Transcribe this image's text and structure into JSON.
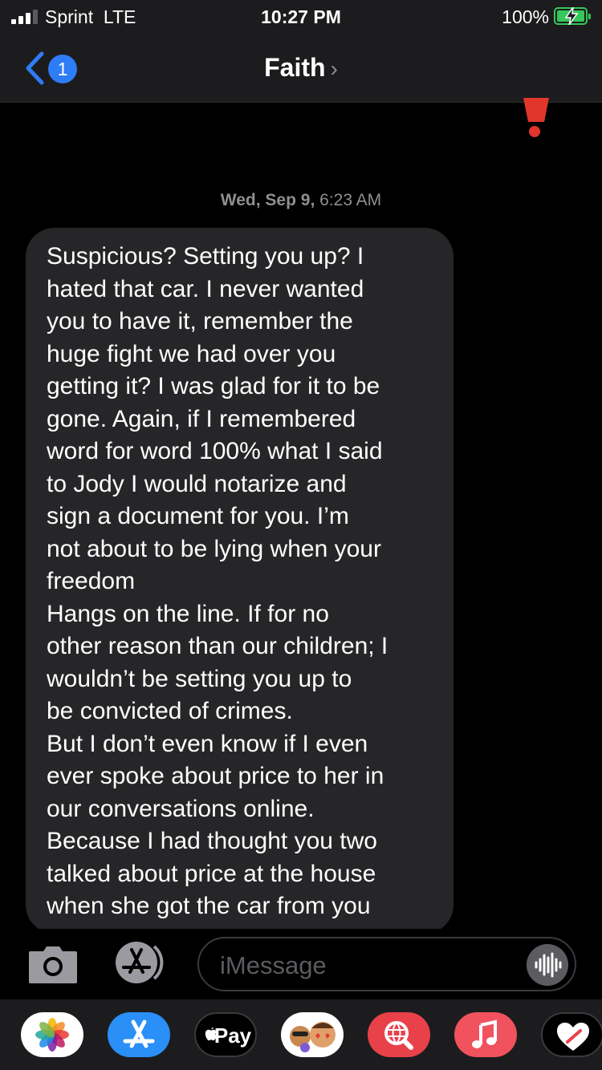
{
  "status_bar": {
    "carrier": "Sprint",
    "network": "LTE",
    "time": "10:27 PM",
    "battery_percent": "100%",
    "battery_state": "charging",
    "signal_bars": 3,
    "signal_max": 4
  },
  "nav": {
    "back_badge": "1",
    "contact_name": "Faith",
    "contact_chevron": "›"
  },
  "error_indicator": {
    "icon": "exclamation-icon",
    "color": "#e0362c"
  },
  "conversation": {
    "timestamp_day": "Wed, Sep 9,",
    "timestamp_time": "6:23 AM",
    "message": "Suspicious? Setting you up? I\nhated that car. I never wanted\nyou to have it, remember the\nhuge fight we had over you\ngetting it? I was glad for it to be\ngone. Again, if I remembered\nword for word 100% what I said\nto Jody I would notarize and\nsign a document for you. I’m\nnot about to be lying when your\nfreedom\nHangs on the line. If for no\nother reason than our children; I\nwouldn’t be setting you up to\nbe convicted of crimes.\nBut I don’t even know if I even\never spoke about price to her in\nour conversations online.\nBecause I had thought you two\ntalked about price at the house\nwhen she got the car from you"
  },
  "input_bar": {
    "placeholder": "iMessage",
    "camera_icon": "camera-icon",
    "apps_icon": "app-store-icon",
    "audio_icon": "audio-waveform-icon"
  },
  "app_drawer": {
    "apps": [
      {
        "name": "photos-app-icon"
      },
      {
        "name": "app-store-app-icon"
      },
      {
        "name": "apple-pay-app-icon",
        "label": "Pay"
      },
      {
        "name": "memoji-app-icon"
      },
      {
        "name": "web-images-app-icon"
      },
      {
        "name": "music-app-icon"
      },
      {
        "name": "digital-touch-app-icon"
      }
    ]
  },
  "colors": {
    "accent": "#2e7cf6",
    "bubble": "#262628",
    "error": "#e0362c",
    "battery": "#35c759"
  }
}
